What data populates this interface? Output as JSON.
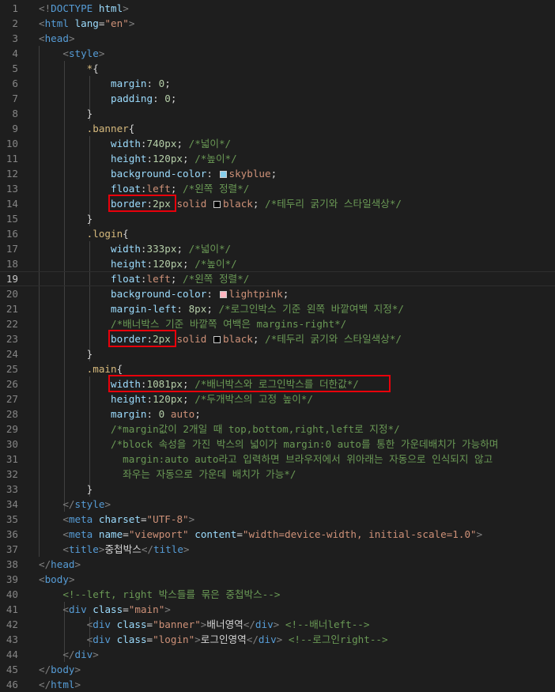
{
  "colors": {
    "skyblue": "#87ceeb",
    "lightpink": "#ffb6c1",
    "black": "#000000",
    "highlight": "#e8000b"
  },
  "lines": [
    {
      "n": "1",
      "tokens": [
        [
          "pn",
          "<!"
        ],
        [
          "tg",
          "DOCTYPE"
        ],
        [
          "tx",
          " "
        ],
        [
          "at",
          "html"
        ],
        [
          "pn",
          ">"
        ]
      ]
    },
    {
      "n": "2",
      "tokens": [
        [
          "pn",
          "<"
        ],
        [
          "tg",
          "html"
        ],
        [
          "tx",
          " "
        ],
        [
          "at",
          "lang"
        ],
        [
          "tx",
          "="
        ],
        [
          "st",
          "\"en\""
        ],
        [
          "pn",
          ">"
        ]
      ]
    },
    {
      "n": "3",
      "tokens": [
        [
          "pn",
          "<"
        ],
        [
          "tg",
          "head"
        ],
        [
          "pn",
          ">"
        ]
      ]
    },
    {
      "n": "4",
      "tokens": [
        [
          "tx",
          "    "
        ],
        [
          "pn",
          "<"
        ],
        [
          "tg",
          "style"
        ],
        [
          "pn",
          ">"
        ]
      ]
    },
    {
      "n": "5",
      "tokens": [
        [
          "tx",
          "        "
        ],
        [
          "sel",
          "*"
        ],
        [
          "tx",
          "{"
        ]
      ]
    },
    {
      "n": "6",
      "tokens": [
        [
          "tx",
          "            "
        ],
        [
          "pr",
          "margin"
        ],
        [
          "tx",
          ": "
        ],
        [
          "nm",
          "0"
        ],
        [
          "tx",
          ";"
        ]
      ]
    },
    {
      "n": "7",
      "tokens": [
        [
          "tx",
          "            "
        ],
        [
          "pr",
          "padding"
        ],
        [
          "tx",
          ": "
        ],
        [
          "nm",
          "0"
        ],
        [
          "tx",
          ";"
        ]
      ]
    },
    {
      "n": "8",
      "tokens": [
        [
          "tx",
          "        }"
        ]
      ]
    },
    {
      "n": "9",
      "tokens": [
        [
          "tx",
          "        "
        ],
        [
          "sel",
          ".banner"
        ],
        [
          "tx",
          "{"
        ]
      ]
    },
    {
      "n": "10",
      "tokens": [
        [
          "tx",
          "            "
        ],
        [
          "pr",
          "width"
        ],
        [
          "tx",
          ":"
        ],
        [
          "nm",
          "740px"
        ],
        [
          "tx",
          "; "
        ],
        [
          "cm",
          "/*넓이*/"
        ]
      ]
    },
    {
      "n": "11",
      "tokens": [
        [
          "tx",
          "            "
        ],
        [
          "pr",
          "height"
        ],
        [
          "tx",
          ":"
        ],
        [
          "nm",
          "120px"
        ],
        [
          "tx",
          "; "
        ],
        [
          "cm",
          "/*높이*/"
        ]
      ]
    },
    {
      "n": "12",
      "tokens": [
        [
          "tx",
          "            "
        ],
        [
          "pr",
          "background-color"
        ],
        [
          "tx",
          ": "
        ],
        [
          "sw",
          "skyblue"
        ],
        [
          "vl",
          "skyblue"
        ],
        [
          "tx",
          ";"
        ]
      ]
    },
    {
      "n": "13",
      "tokens": [
        [
          "tx",
          "            "
        ],
        [
          "pr",
          "float"
        ],
        [
          "tx",
          ":"
        ],
        [
          "vl",
          "left"
        ],
        [
          "tx",
          "; "
        ],
        [
          "cm",
          "/*왼쪽 정렬*/"
        ]
      ]
    },
    {
      "n": "14",
      "tokens": [
        [
          "tx",
          "            "
        ],
        [
          "pr",
          "border"
        ],
        [
          "tx",
          ":"
        ],
        [
          "nm",
          "2px"
        ],
        [
          "tx",
          " "
        ],
        [
          "vl",
          "solid"
        ],
        [
          "tx",
          " "
        ],
        [
          "sw",
          "black"
        ],
        [
          "vl",
          "black"
        ],
        [
          "tx",
          "; "
        ],
        [
          "cm",
          "/*테두리 굵기와 스타일색상*/"
        ]
      ]
    },
    {
      "n": "15",
      "tokens": [
        [
          "tx",
          "        }"
        ]
      ]
    },
    {
      "n": "16",
      "tokens": [
        [
          "tx",
          "        "
        ],
        [
          "sel",
          ".login"
        ],
        [
          "tx",
          "{"
        ]
      ]
    },
    {
      "n": "17",
      "tokens": [
        [
          "tx",
          "            "
        ],
        [
          "pr",
          "width"
        ],
        [
          "tx",
          ":"
        ],
        [
          "nm",
          "333px"
        ],
        [
          "tx",
          "; "
        ],
        [
          "cm",
          "/*넓이*/"
        ]
      ]
    },
    {
      "n": "18",
      "tokens": [
        [
          "tx",
          "            "
        ],
        [
          "pr",
          "height"
        ],
        [
          "tx",
          ":"
        ],
        [
          "nm",
          "120px"
        ],
        [
          "tx",
          "; "
        ],
        [
          "cm",
          "/*높이*/"
        ]
      ]
    },
    {
      "n": "19",
      "current": true,
      "tokens": [
        [
          "tx",
          "            "
        ],
        [
          "pr",
          "float"
        ],
        [
          "tx",
          ":"
        ],
        [
          "vl",
          "left"
        ],
        [
          "tx",
          "; "
        ],
        [
          "cm",
          "/*왼쪽 정렬*/"
        ]
      ]
    },
    {
      "n": "20",
      "tokens": [
        [
          "tx",
          "            "
        ],
        [
          "pr",
          "background-color"
        ],
        [
          "tx",
          ": "
        ],
        [
          "sw",
          "lightpink"
        ],
        [
          "vl",
          "lightpink"
        ],
        [
          "tx",
          ";"
        ]
      ]
    },
    {
      "n": "21",
      "tokens": [
        [
          "tx",
          "            "
        ],
        [
          "pr",
          "margin-left"
        ],
        [
          "tx",
          ": "
        ],
        [
          "nm",
          "8px"
        ],
        [
          "tx",
          "; "
        ],
        [
          "cm",
          "/*로그인박스 기준 왼쪽 바깥여백 지정*/"
        ]
      ]
    },
    {
      "n": "22",
      "tokens": [
        [
          "tx",
          "            "
        ],
        [
          "cm",
          "/*배너박스 기준 바깥쪽 여백은 margins-right*/"
        ]
      ]
    },
    {
      "n": "23",
      "tokens": [
        [
          "tx",
          "            "
        ],
        [
          "pr",
          "border"
        ],
        [
          "tx",
          ":"
        ],
        [
          "nm",
          "2px"
        ],
        [
          "tx",
          " "
        ],
        [
          "vl",
          "solid"
        ],
        [
          "tx",
          " "
        ],
        [
          "sw",
          "black"
        ],
        [
          "vl",
          "black"
        ],
        [
          "tx",
          "; "
        ],
        [
          "cm",
          "/*테두리 굵기와 스타일색상*/"
        ]
      ]
    },
    {
      "n": "24",
      "tokens": [
        [
          "tx",
          "        }"
        ]
      ]
    },
    {
      "n": "25",
      "tokens": [
        [
          "tx",
          "        "
        ],
        [
          "sel",
          ".main"
        ],
        [
          "tx",
          "{"
        ]
      ]
    },
    {
      "n": "26",
      "tokens": [
        [
          "tx",
          "            "
        ],
        [
          "pr",
          "width"
        ],
        [
          "tx",
          ":"
        ],
        [
          "nm",
          "1081px"
        ],
        [
          "tx",
          "; "
        ],
        [
          "cm",
          "/*배너박스와 로그인박스를 더한값*/"
        ]
      ]
    },
    {
      "n": "27",
      "tokens": [
        [
          "tx",
          "            "
        ],
        [
          "pr",
          "height"
        ],
        [
          "tx",
          ":"
        ],
        [
          "nm",
          "120px"
        ],
        [
          "tx",
          "; "
        ],
        [
          "cm",
          "/*두개박스의 고정 높이*/"
        ]
      ]
    },
    {
      "n": "28",
      "tokens": [
        [
          "tx",
          "            "
        ],
        [
          "pr",
          "margin"
        ],
        [
          "tx",
          ": "
        ],
        [
          "nm",
          "0"
        ],
        [
          "tx",
          " "
        ],
        [
          "vl",
          "auto"
        ],
        [
          "tx",
          ";"
        ]
      ]
    },
    {
      "n": "29",
      "tokens": [
        [
          "tx",
          "            "
        ],
        [
          "cm",
          "/*margin값이 2개일 때 top,bottom,right,left로 지정*/"
        ]
      ]
    },
    {
      "n": "30",
      "tokens": [
        [
          "tx",
          "            "
        ],
        [
          "cm",
          "/*block 속성을 가진 박스의 넓이가 margin:0 auto를 통한 가운데배치가 가능하며"
        ]
      ]
    },
    {
      "n": "31",
      "tokens": [
        [
          "tx",
          "              "
        ],
        [
          "cm",
          "margin:auto auto라고 입력하면 브라우저에서 위아래는 자동으로 인식되지 않고"
        ]
      ]
    },
    {
      "n": "32",
      "tokens": [
        [
          "tx",
          "              "
        ],
        [
          "cm",
          "좌우는 자동으로 가운데 배치가 가능*/"
        ]
      ]
    },
    {
      "n": "33",
      "tokens": [
        [
          "tx",
          "        }"
        ]
      ]
    },
    {
      "n": "34",
      "tokens": [
        [
          "tx",
          "    "
        ],
        [
          "pn",
          "</"
        ],
        [
          "tg",
          "style"
        ],
        [
          "pn",
          ">"
        ]
      ]
    },
    {
      "n": "35",
      "tokens": [
        [
          "tx",
          "    "
        ],
        [
          "pn",
          "<"
        ],
        [
          "tg",
          "meta"
        ],
        [
          "tx",
          " "
        ],
        [
          "at",
          "charset"
        ],
        [
          "tx",
          "="
        ],
        [
          "st",
          "\"UTF-8\""
        ],
        [
          "pn",
          ">"
        ]
      ]
    },
    {
      "n": "36",
      "tokens": [
        [
          "tx",
          "    "
        ],
        [
          "pn",
          "<"
        ],
        [
          "tg",
          "meta"
        ],
        [
          "tx",
          " "
        ],
        [
          "at",
          "name"
        ],
        [
          "tx",
          "="
        ],
        [
          "st",
          "\"viewport\""
        ],
        [
          "tx",
          " "
        ],
        [
          "at",
          "content"
        ],
        [
          "tx",
          "="
        ],
        [
          "st",
          "\"width=device-width, initial-scale=1.0\""
        ],
        [
          "pn",
          ">"
        ]
      ]
    },
    {
      "n": "37",
      "tokens": [
        [
          "tx",
          "    "
        ],
        [
          "pn",
          "<"
        ],
        [
          "tg",
          "title"
        ],
        [
          "pn",
          ">"
        ],
        [
          "tx",
          "중첩박스"
        ],
        [
          "pn",
          "</"
        ],
        [
          "tg",
          "title"
        ],
        [
          "pn",
          ">"
        ]
      ]
    },
    {
      "n": "38",
      "tokens": [
        [
          "pn",
          "</"
        ],
        [
          "tg",
          "head"
        ],
        [
          "pn",
          ">"
        ]
      ]
    },
    {
      "n": "39",
      "tokens": [
        [
          "pn",
          "<"
        ],
        [
          "tg",
          "body"
        ],
        [
          "pn",
          ">"
        ]
      ]
    },
    {
      "n": "40",
      "tokens": [
        [
          "tx",
          "    "
        ],
        [
          "cm",
          "<!--left, right 박스들를 묶은 중첩박스-->"
        ]
      ]
    },
    {
      "n": "41",
      "tokens": [
        [
          "tx",
          "    "
        ],
        [
          "pn",
          "<"
        ],
        [
          "tg",
          "div"
        ],
        [
          "tx",
          " "
        ],
        [
          "at",
          "class"
        ],
        [
          "tx",
          "="
        ],
        [
          "st",
          "\"main\""
        ],
        [
          "pn",
          ">"
        ]
      ]
    },
    {
      "n": "42",
      "tokens": [
        [
          "tx",
          "        "
        ],
        [
          "pn",
          "<"
        ],
        [
          "tg",
          "div"
        ],
        [
          "tx",
          " "
        ],
        [
          "at",
          "class"
        ],
        [
          "tx",
          "="
        ],
        [
          "st",
          "\"banner\""
        ],
        [
          "pn",
          ">"
        ],
        [
          "tx",
          "배너영역"
        ],
        [
          "pn",
          "</"
        ],
        [
          "tg",
          "div"
        ],
        [
          "pn",
          ">"
        ],
        [
          "tx",
          " "
        ],
        [
          "cm",
          "<!--배너left-->"
        ]
      ]
    },
    {
      "n": "43",
      "tokens": [
        [
          "tx",
          "        "
        ],
        [
          "pn",
          "<"
        ],
        [
          "tg",
          "div"
        ],
        [
          "tx",
          " "
        ],
        [
          "at",
          "class"
        ],
        [
          "tx",
          "="
        ],
        [
          "st",
          "\"login\""
        ],
        [
          "pn",
          ">"
        ],
        [
          "tx",
          "로그인영역"
        ],
        [
          "pn",
          "</"
        ],
        [
          "tg",
          "div"
        ],
        [
          "pn",
          ">"
        ],
        [
          "tx",
          " "
        ],
        [
          "cm",
          "<!--로그인right-->"
        ]
      ]
    },
    {
      "n": "44",
      "tokens": [
        [
          "tx",
          "    "
        ],
        [
          "pn",
          "</"
        ],
        [
          "tg",
          "div"
        ],
        [
          "pn",
          ">"
        ]
      ]
    },
    {
      "n": "45",
      "tokens": [
        [
          "pn",
          "</"
        ],
        [
          "tg",
          "body"
        ],
        [
          "pn",
          ">"
        ]
      ]
    },
    {
      "n": "46",
      "tokens": [
        [
          "pn",
          "</"
        ],
        [
          "tg",
          "html"
        ],
        [
          "pn",
          ">"
        ]
      ]
    }
  ]
}
